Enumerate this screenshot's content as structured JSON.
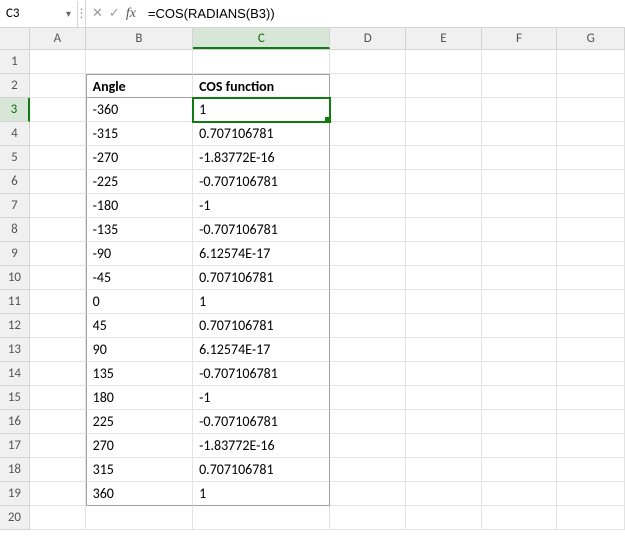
{
  "nameBox": "C3",
  "formula": "=COS(RADIANS(B3))",
  "columns": [
    "A",
    "B",
    "C",
    "D",
    "E",
    "F",
    "G"
  ],
  "activeCol": "C",
  "activeRow": 3,
  "rowCount": 20,
  "headers": {
    "B": "Angle",
    "C": "COS function"
  },
  "table": [
    {
      "angle": "-360",
      "cos": "1"
    },
    {
      "angle": "-315",
      "cos": "0.707106781"
    },
    {
      "angle": "-270",
      "cos": "-1.83772E-16"
    },
    {
      "angle": "-225",
      "cos": "-0.707106781"
    },
    {
      "angle": "-180",
      "cos": "-1"
    },
    {
      "angle": "-135",
      "cos": "-0.707106781"
    },
    {
      "angle": "-90",
      "cos": "6.12574E-17"
    },
    {
      "angle": "-45",
      "cos": "0.707106781"
    },
    {
      "angle": "0",
      "cos": "1"
    },
    {
      "angle": "45",
      "cos": "0.707106781"
    },
    {
      "angle": "90",
      "cos": "6.12574E-17"
    },
    {
      "angle": "135",
      "cos": "-0.707106781"
    },
    {
      "angle": "180",
      "cos": "-1"
    },
    {
      "angle": "225",
      "cos": "-0.707106781"
    },
    {
      "angle": "270",
      "cos": "-1.83772E-16"
    },
    {
      "angle": "315",
      "cos": "0.707106781"
    },
    {
      "angle": "360",
      "cos": "1"
    }
  ]
}
